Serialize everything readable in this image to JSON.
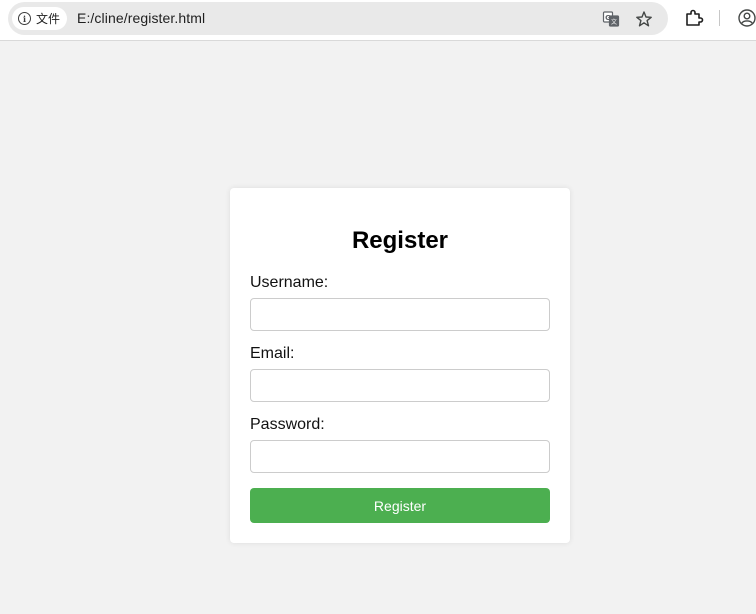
{
  "browser": {
    "site_chip_label": "文件",
    "url": "E:/cline/register.html",
    "icons": [
      "info-icon",
      "translate-icon",
      "bookmark-star-icon",
      "extensions-icon",
      "profile-icon"
    ]
  },
  "form": {
    "title": "Register",
    "fields": [
      {
        "label": "Username:",
        "value": "",
        "type": "text"
      },
      {
        "label": "Email:",
        "value": "",
        "type": "email"
      },
      {
        "label": "Password:",
        "value": "",
        "type": "password"
      }
    ],
    "submit_label": "Register"
  },
  "colors": {
    "page_background": "#f2f2f2",
    "card_background": "#ffffff",
    "button_background": "#4caf50",
    "button_text": "#ffffff"
  }
}
